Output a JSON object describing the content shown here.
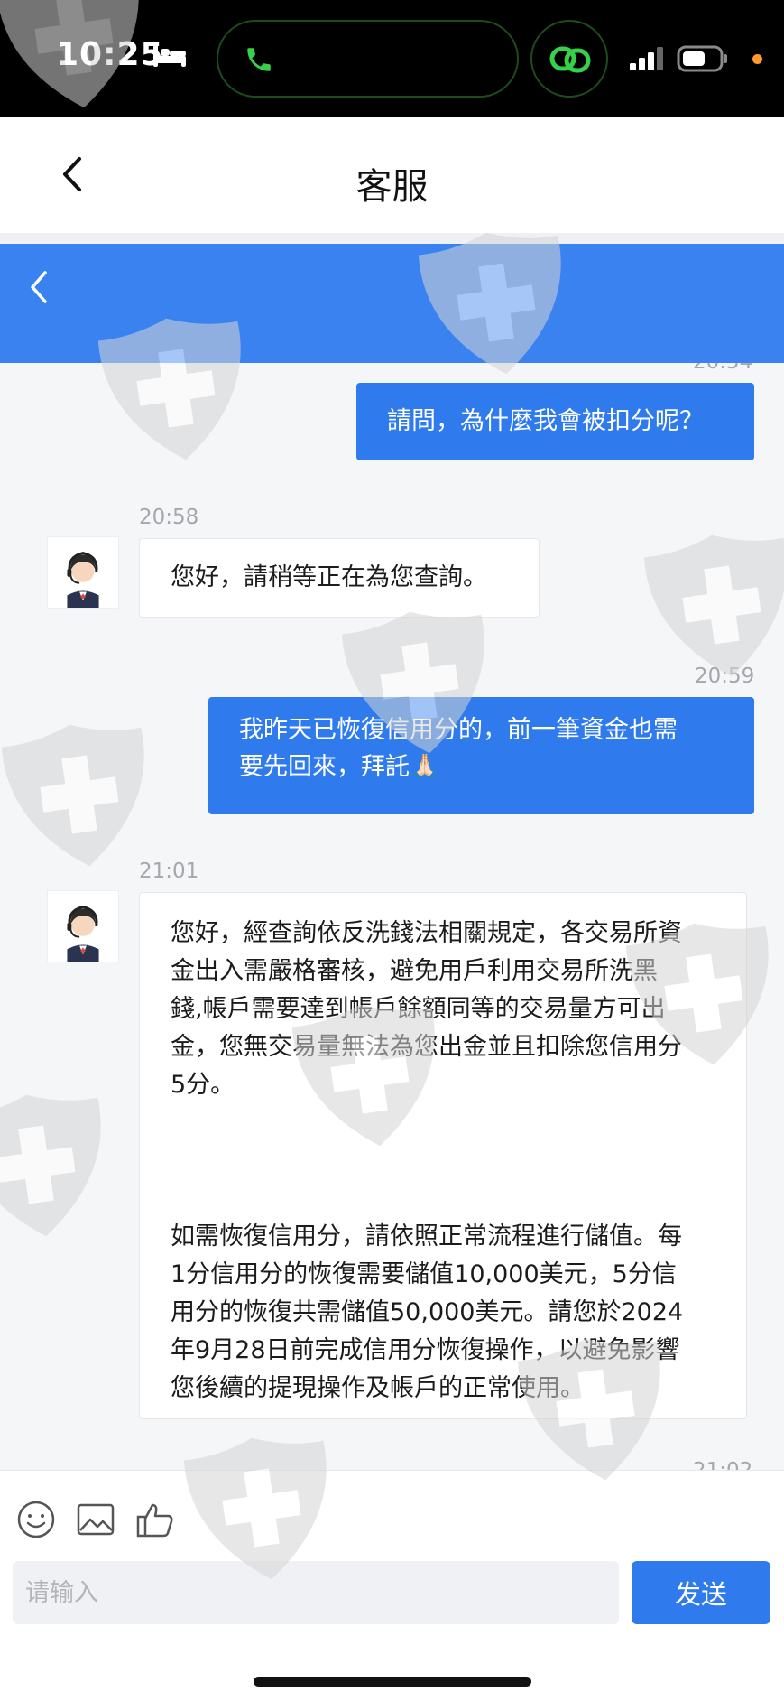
{
  "status_bar": {
    "time": "10:25",
    "icons": [
      "bed-icon",
      "phone-icon",
      "link-icon",
      "signal-icon",
      "battery-icon"
    ]
  },
  "header": {
    "title": "客服",
    "back_icon": "chevron-left-icon"
  },
  "banner": {
    "color": "#3b82f1",
    "back_icon": "chevron-left-icon"
  },
  "chat": {
    "partial_top_timestamp": "20:54",
    "messages": [
      {
        "from": "user",
        "text": "請問，為什麼我會被扣分呢？"
      },
      {
        "from": "agent",
        "time": "20:58",
        "text": "您好，請稍等正在為您查詢。"
      },
      {
        "from": "user",
        "time": "20:59",
        "lines": [
          "我昨天已恢復信用分的，前一筆資金也需",
          "要先回來，拜託🙏🏻"
        ]
      },
      {
        "from": "agent",
        "time": "21:01",
        "paragraph1": [
          "您好，經查詢依反洗錢法相關規定，各交易所資",
          "金出入需嚴格審核，避免用戶利用交易所洗黑",
          "錢,帳戶需要達到帳戶餘額同等的交易量方可出",
          "金，您無交易量無法為您出金並且扣除您信用分",
          "5分。"
        ],
        "paragraph2": [
          "如需恢復信用分，請依照正常流程進行儲值。每",
          "1分信用分的恢復需要儲值10,000美元，5分信",
          "用分的恢復共需儲值50,000美元。請您於2024",
          "年9月28日前完成信用分恢復操作，以避免影響",
          "您後續的提現操作及帳戶的正常使用。"
        ]
      }
    ],
    "partial_bottom_timestamp": "21:02"
  },
  "input": {
    "placeholder": "请输入",
    "send_label": "发送",
    "tools": [
      "emoji-icon",
      "image-icon",
      "thumbs-up-icon"
    ]
  },
  "colors": {
    "accent": "#2f7bee",
    "status_bar": "#000000",
    "battery_dot": "#ff9a2e"
  }
}
